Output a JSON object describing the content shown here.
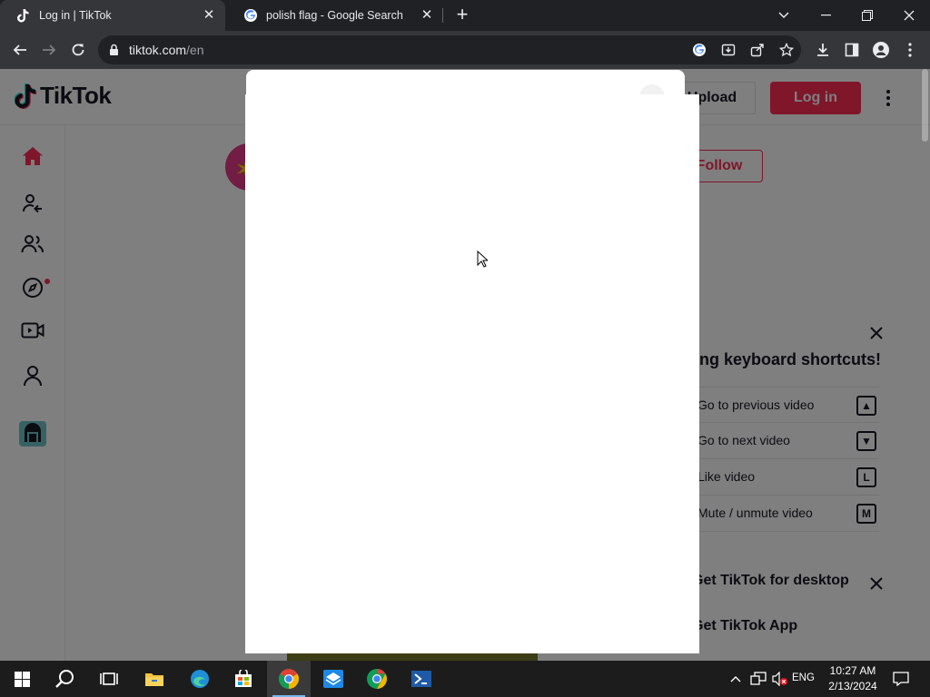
{
  "browser": {
    "tabs": [
      {
        "title": "Log in | TikTok",
        "active": true,
        "favicon": "tiktok-icon"
      },
      {
        "title": "polish flag - Google Search",
        "active": false,
        "favicon": "google-icon"
      }
    ],
    "new_tab_label": "+",
    "address": {
      "host": "tiktok.com",
      "path": "/en"
    }
  },
  "tiktok": {
    "logo_text": "TikTok",
    "header": {
      "upload_label": "Upload",
      "login_label": "Log in"
    },
    "sidebar": [
      {
        "name": "For You",
        "icon": "home-icon"
      },
      {
        "name": "Following",
        "icon": "following-icon"
      },
      {
        "name": "Friends",
        "icon": "friends-icon"
      },
      {
        "name": "Explore",
        "icon": "compass-icon"
      },
      {
        "name": "LIVE",
        "icon": "live-icon"
      },
      {
        "name": "Profile",
        "icon": "profile-icon"
      },
      {
        "name": "More",
        "icon": "gallery-icon"
      }
    ],
    "feed": {
      "follow_label": "Follow"
    },
    "shortcuts_panel": {
      "title": "Introducing keyboard shortcuts!",
      "rows": [
        {
          "label": "Go to previous video",
          "key": "▲"
        },
        {
          "label": "Go to next video",
          "key": "▼"
        },
        {
          "label": "Like video",
          "key": "L"
        },
        {
          "label": "Mute / unmute video",
          "key": "M"
        }
      ]
    },
    "get_desktop": "Get TikTok for desktop",
    "get_app": "Get TikTok App"
  },
  "taskbar": {
    "apps": [
      "start-icon",
      "search-icon",
      "task-view-icon",
      "file-explorer-icon",
      "edge-icon",
      "store-icon",
      "chrome-icon",
      "mail-app-icon",
      "chrome-alt-icon",
      "terminal-icon"
    ],
    "language": "ENG",
    "time": "10:27 AM",
    "date": "2/13/2024"
  },
  "colors": {
    "accent": "#fe2c55",
    "chrome_dark": "#202124",
    "chrome_toolbar": "#35363a"
  }
}
